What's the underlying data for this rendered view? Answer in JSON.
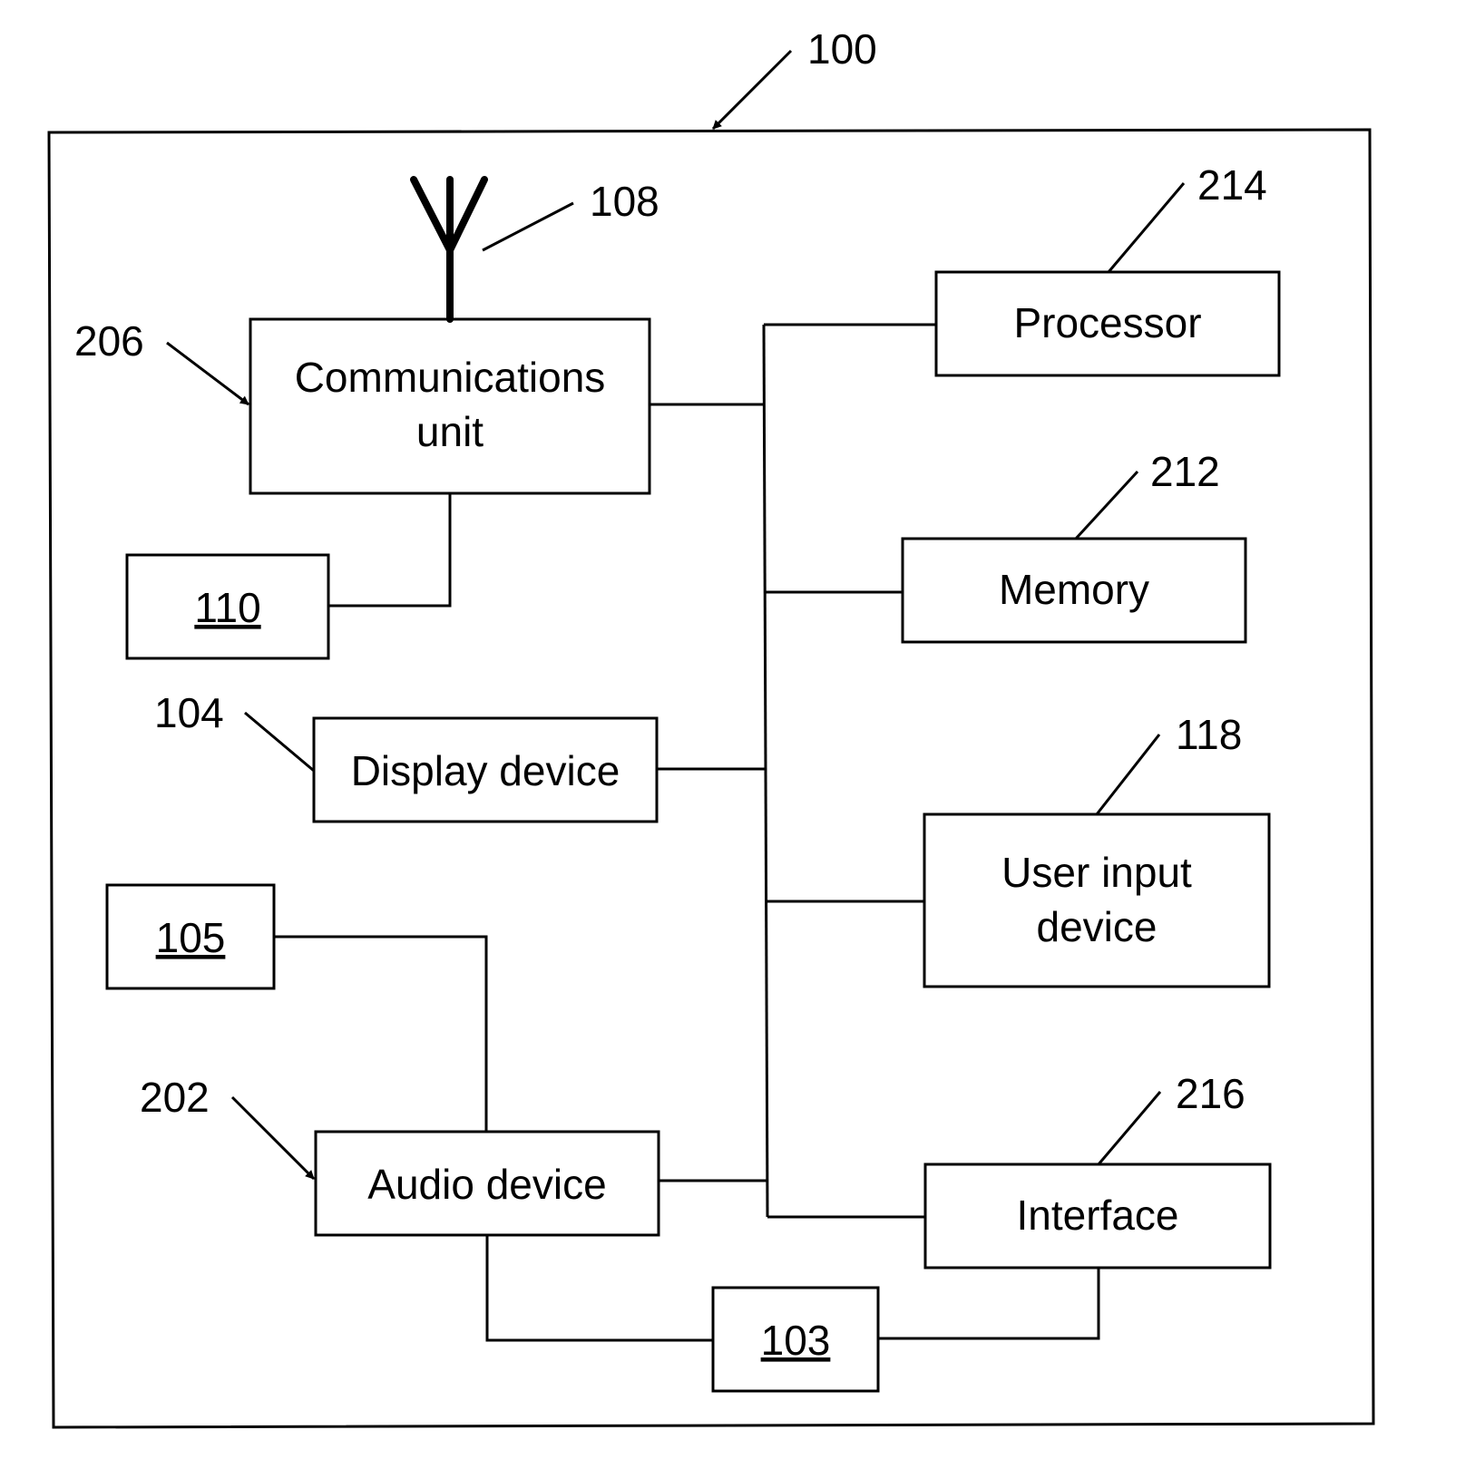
{
  "figure": {
    "ref": "100"
  },
  "blocks": {
    "comm": {
      "lines": [
        "Communications",
        "unit"
      ],
      "ref": "206"
    },
    "antenna": {
      "ref": "108"
    },
    "box110": {
      "label": "110"
    },
    "display": {
      "label": "Display device",
      "ref": "104"
    },
    "box105": {
      "label": "105"
    },
    "audio": {
      "label": "Audio device",
      "ref": "202"
    },
    "box103": {
      "label": "103"
    },
    "processor": {
      "label": "Processor",
      "ref": "214"
    },
    "memory": {
      "label": "Memory",
      "ref": "212"
    },
    "userinput": {
      "lines": [
        "User input",
        "device"
      ],
      "ref": "118"
    },
    "interface": {
      "label": "Interface",
      "ref": "216"
    }
  }
}
